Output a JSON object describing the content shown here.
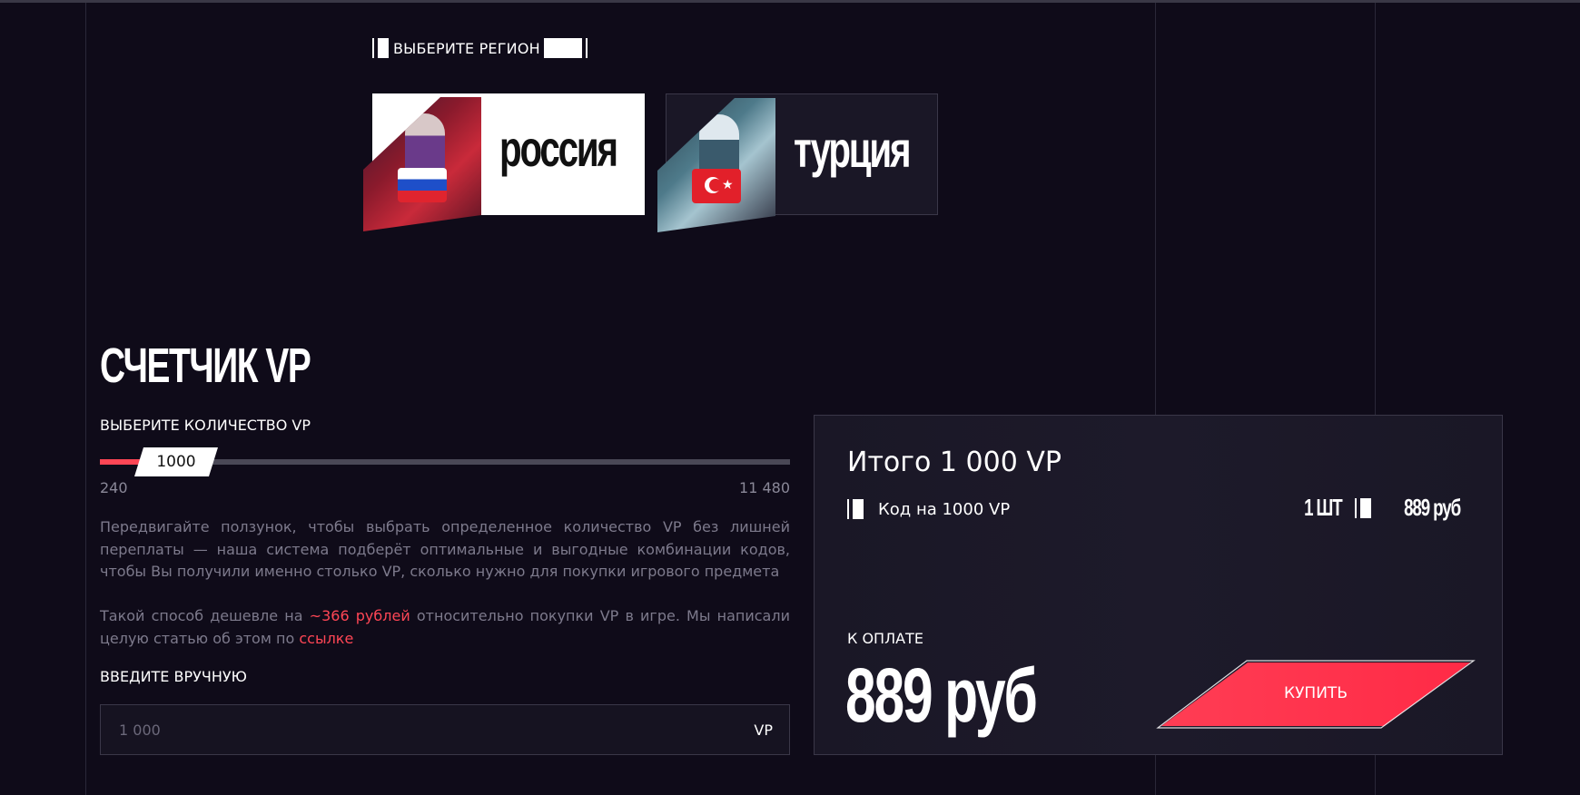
{
  "region": {
    "label": "ВЫБЕРИТЕ РЕГИОН",
    "options": [
      {
        "name": "россия",
        "flag": "russia-flag"
      },
      {
        "name": "турция",
        "flag": "turkey-flag"
      }
    ],
    "selected": "россия"
  },
  "counter": {
    "title": "СЧЕТЧИК VP",
    "select_label": "ВЫБЕРИТЕ КОЛИЧЕСТВО VP",
    "slider_value": "1000",
    "slider_min": "240",
    "slider_max": "11 480",
    "slider_fraction": 0.067
  },
  "description": {
    "p1": "Передвигайте ползунок, чтобы выбрать определенное количество VP без лишней переплаты — наша система подберёт оптимальные и выгодные комбинации кодов, чтобы Вы получили именно столько VP, сколько нужно для покупки игрового предмета",
    "p2_before": "Такой способ дешевле на ",
    "p2_highlight": "~366 рублей",
    "p2_after": " относительно покупки VP в игре. Мы написали целую статью об этом по ",
    "p2_link": "ссылке"
  },
  "manual": {
    "label": "ВВЕДИТЕ ВРУЧНУЮ",
    "placeholder": "1 000",
    "unit": "VP"
  },
  "summary": {
    "title": "Итого 1 000 VP",
    "item_label": "Код на 1000 VP",
    "item_qty": "1 ШТ",
    "item_price": "889 руб",
    "pay_label": "К ОПЛАТЕ",
    "pay_total": "889 руб",
    "buy_label": "КУПИТЬ"
  },
  "colors": {
    "background": "#0f0b19",
    "panel": "#1a1726",
    "accent": "#ff4655",
    "muted_text": "#7d7a8c"
  }
}
